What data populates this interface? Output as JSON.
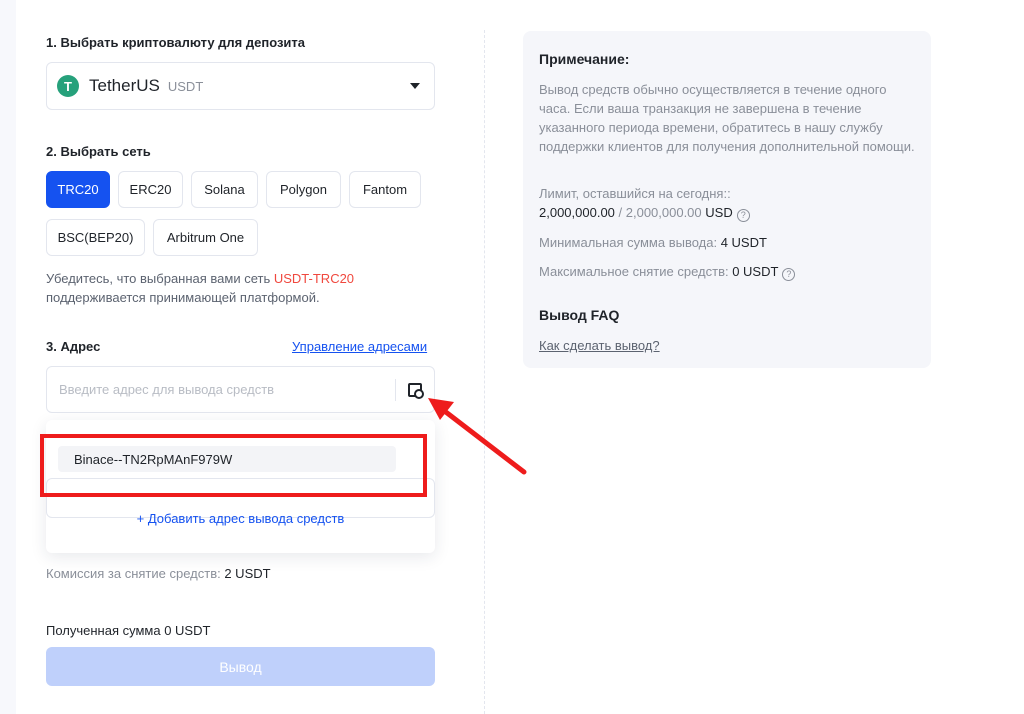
{
  "steps": {
    "step1": "1. Выбрать криптовалюту для депозита",
    "step2": "2. Выбрать сеть",
    "step3": "3. Адрес"
  },
  "currency": {
    "icon_letter": "T",
    "name": "TetherUS",
    "ticker": "USDT",
    "icon_color": "#26a17b"
  },
  "networks": [
    "TRC20",
    "ERC20",
    "Solana",
    "Polygon",
    "Fantom",
    "BSC(BEP20)",
    "Arbitrum One"
  ],
  "selected_network": "TRC20",
  "network_note": {
    "before": "Убедитесь, что выбранная вами сеть ",
    "highlight": "USDT-TRC20",
    "after": " поддерживается принимающей платформой."
  },
  "address": {
    "manage_link": "Управление адресами",
    "placeholder": "Введите адрес для вывода средств"
  },
  "dropdown": {
    "saved_address": "Binace--TN2RpMAnF979W",
    "add_address": "+ Добавить адрес вывода средств"
  },
  "fee": {
    "label": "Комиссия за снятие средств: ",
    "value": "2 USDT"
  },
  "received": {
    "label": "Полученная сумма ",
    "value": "0 USDT"
  },
  "submit_label": "Вывод",
  "panel": {
    "title": "Примечание:",
    "description": "Вывод средств обычно осуществляется в течение одного часа. Если ваша транзакция не завершена в течение указанного периода времени, обратитесь в нашу службу поддержки клиентов для получения дополнительной помощи.",
    "limit_label": "Лимит, оставшийся на сегодня::",
    "limit_used": "2,000,000.00",
    "limit_total": " / 2,000,000.00",
    "limit_unit": " USD",
    "min_label": "Минимальная сумма вывода: ",
    "min_value": "4 USDT",
    "max_label": "Максимальное снятие средств: ",
    "max_value": "0 USDT",
    "faq_title": "Вывод FAQ",
    "faq_link": "Как сделать вывод?"
  },
  "colors": {
    "accent": "#1552f0",
    "warning": "#f0483e",
    "annotation": "#ee1c1c"
  }
}
